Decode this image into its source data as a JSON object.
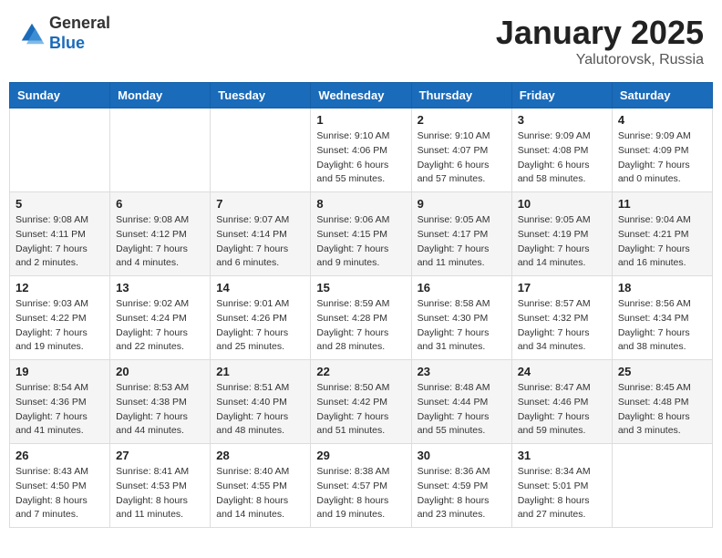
{
  "header": {
    "logo_general": "General",
    "logo_blue": "Blue",
    "title": "January 2025",
    "subtitle": "Yalutorovsk, Russia"
  },
  "weekdays": [
    "Sunday",
    "Monday",
    "Tuesday",
    "Wednesday",
    "Thursday",
    "Friday",
    "Saturday"
  ],
  "weeks": [
    [
      {
        "day": "",
        "info": ""
      },
      {
        "day": "",
        "info": ""
      },
      {
        "day": "",
        "info": ""
      },
      {
        "day": "1",
        "info": "Sunrise: 9:10 AM\nSunset: 4:06 PM\nDaylight: 6 hours\nand 55 minutes."
      },
      {
        "day": "2",
        "info": "Sunrise: 9:10 AM\nSunset: 4:07 PM\nDaylight: 6 hours\nand 57 minutes."
      },
      {
        "day": "3",
        "info": "Sunrise: 9:09 AM\nSunset: 4:08 PM\nDaylight: 6 hours\nand 58 minutes."
      },
      {
        "day": "4",
        "info": "Sunrise: 9:09 AM\nSunset: 4:09 PM\nDaylight: 7 hours\nand 0 minutes."
      }
    ],
    [
      {
        "day": "5",
        "info": "Sunrise: 9:08 AM\nSunset: 4:11 PM\nDaylight: 7 hours\nand 2 minutes."
      },
      {
        "day": "6",
        "info": "Sunrise: 9:08 AM\nSunset: 4:12 PM\nDaylight: 7 hours\nand 4 minutes."
      },
      {
        "day": "7",
        "info": "Sunrise: 9:07 AM\nSunset: 4:14 PM\nDaylight: 7 hours\nand 6 minutes."
      },
      {
        "day": "8",
        "info": "Sunrise: 9:06 AM\nSunset: 4:15 PM\nDaylight: 7 hours\nand 9 minutes."
      },
      {
        "day": "9",
        "info": "Sunrise: 9:05 AM\nSunset: 4:17 PM\nDaylight: 7 hours\nand 11 minutes."
      },
      {
        "day": "10",
        "info": "Sunrise: 9:05 AM\nSunset: 4:19 PM\nDaylight: 7 hours\nand 14 minutes."
      },
      {
        "day": "11",
        "info": "Sunrise: 9:04 AM\nSunset: 4:21 PM\nDaylight: 7 hours\nand 16 minutes."
      }
    ],
    [
      {
        "day": "12",
        "info": "Sunrise: 9:03 AM\nSunset: 4:22 PM\nDaylight: 7 hours\nand 19 minutes."
      },
      {
        "day": "13",
        "info": "Sunrise: 9:02 AM\nSunset: 4:24 PM\nDaylight: 7 hours\nand 22 minutes."
      },
      {
        "day": "14",
        "info": "Sunrise: 9:01 AM\nSunset: 4:26 PM\nDaylight: 7 hours\nand 25 minutes."
      },
      {
        "day": "15",
        "info": "Sunrise: 8:59 AM\nSunset: 4:28 PM\nDaylight: 7 hours\nand 28 minutes."
      },
      {
        "day": "16",
        "info": "Sunrise: 8:58 AM\nSunset: 4:30 PM\nDaylight: 7 hours\nand 31 minutes."
      },
      {
        "day": "17",
        "info": "Sunrise: 8:57 AM\nSunset: 4:32 PM\nDaylight: 7 hours\nand 34 minutes."
      },
      {
        "day": "18",
        "info": "Sunrise: 8:56 AM\nSunset: 4:34 PM\nDaylight: 7 hours\nand 38 minutes."
      }
    ],
    [
      {
        "day": "19",
        "info": "Sunrise: 8:54 AM\nSunset: 4:36 PM\nDaylight: 7 hours\nand 41 minutes."
      },
      {
        "day": "20",
        "info": "Sunrise: 8:53 AM\nSunset: 4:38 PM\nDaylight: 7 hours\nand 44 minutes."
      },
      {
        "day": "21",
        "info": "Sunrise: 8:51 AM\nSunset: 4:40 PM\nDaylight: 7 hours\nand 48 minutes."
      },
      {
        "day": "22",
        "info": "Sunrise: 8:50 AM\nSunset: 4:42 PM\nDaylight: 7 hours\nand 51 minutes."
      },
      {
        "day": "23",
        "info": "Sunrise: 8:48 AM\nSunset: 4:44 PM\nDaylight: 7 hours\nand 55 minutes."
      },
      {
        "day": "24",
        "info": "Sunrise: 8:47 AM\nSunset: 4:46 PM\nDaylight: 7 hours\nand 59 minutes."
      },
      {
        "day": "25",
        "info": "Sunrise: 8:45 AM\nSunset: 4:48 PM\nDaylight: 8 hours\nand 3 minutes."
      }
    ],
    [
      {
        "day": "26",
        "info": "Sunrise: 8:43 AM\nSunset: 4:50 PM\nDaylight: 8 hours\nand 7 minutes."
      },
      {
        "day": "27",
        "info": "Sunrise: 8:41 AM\nSunset: 4:53 PM\nDaylight: 8 hours\nand 11 minutes."
      },
      {
        "day": "28",
        "info": "Sunrise: 8:40 AM\nSunset: 4:55 PM\nDaylight: 8 hours\nand 14 minutes."
      },
      {
        "day": "29",
        "info": "Sunrise: 8:38 AM\nSunset: 4:57 PM\nDaylight: 8 hours\nand 19 minutes."
      },
      {
        "day": "30",
        "info": "Sunrise: 8:36 AM\nSunset: 4:59 PM\nDaylight: 8 hours\nand 23 minutes."
      },
      {
        "day": "31",
        "info": "Sunrise: 8:34 AM\nSunset: 5:01 PM\nDaylight: 8 hours\nand 27 minutes."
      },
      {
        "day": "",
        "info": ""
      }
    ]
  ]
}
